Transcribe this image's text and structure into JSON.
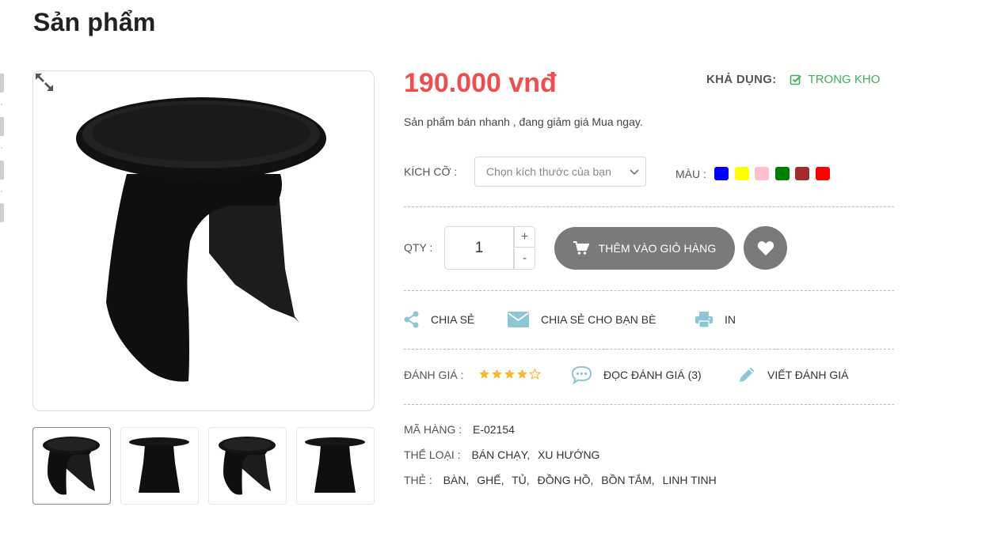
{
  "page": {
    "title": "Sản phẩm"
  },
  "product": {
    "price": "190.000 vnđ",
    "availability_label": "KHẢ DỤNG:",
    "availability_value": "TRONG KHO",
    "description": "Sản phẩm bán nhanh , đang giảm giá Mua ngay."
  },
  "options": {
    "size_label": "KÍCH CỠ :",
    "size_placeholder": "Chọn kích thước của bạn",
    "color_label": "MÀU :",
    "colors": [
      "#0000ff",
      "#ffff00",
      "#ffc0cb",
      "#008000",
      "#a52a2a",
      "#ff0000"
    ]
  },
  "purchase": {
    "qty_label": "QTY :",
    "qty_value": "1",
    "plus": "+",
    "minus": "-",
    "add_to_cart": "THÊM VÀO GIỎ HÀNG"
  },
  "share": {
    "share": "CHIA SẺ",
    "share_friends": "CHIA SẺ CHO BẠN BÈ",
    "print": "IN"
  },
  "rating": {
    "label": "ĐÁNH GIÁ :",
    "stars": 4,
    "max_stars": 5,
    "read_reviews": "ĐỌC ĐÁNH GIÁ (3)",
    "write_review": "VIẾT ĐÁNH GIÁ"
  },
  "meta": {
    "sku_label": "MÃ HÀNG :",
    "sku_value": "E-02154",
    "category_label": "THỂ LOẠI :",
    "categories": [
      "BÁN CHẠY,",
      "XU HƯỚNG"
    ],
    "tags_label": "THẺ :",
    "tags": [
      "BÀN,",
      "GHẾ,",
      "TỦ,",
      "ĐỒNG HỒ,",
      "BỒN TẮM,",
      "LINH TINH"
    ]
  }
}
